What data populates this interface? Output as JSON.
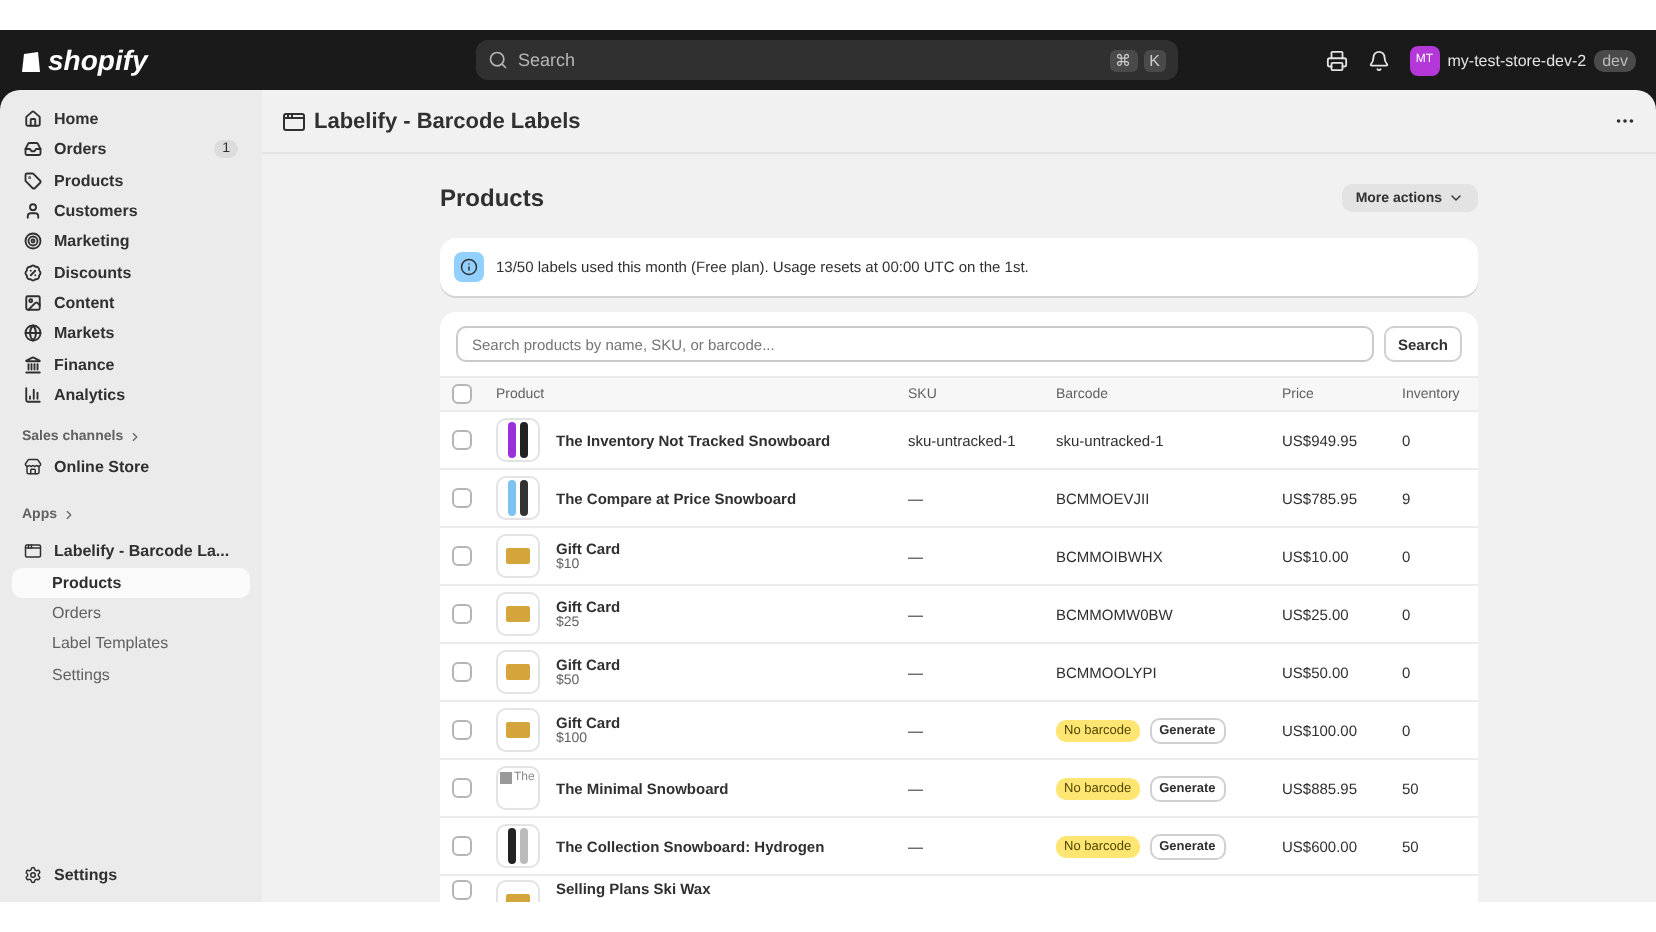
{
  "topbar": {
    "brand": "shopify",
    "search": {
      "placeholder": "Search",
      "keys": [
        "⌘",
        "K"
      ]
    },
    "store": {
      "initials": "MT",
      "name": "my-test-store-dev-2",
      "badge": "dev"
    }
  },
  "sidebar": {
    "items": [
      {
        "label": "Home"
      },
      {
        "label": "Orders",
        "count": "1"
      },
      {
        "label": "Products"
      },
      {
        "label": "Customers"
      },
      {
        "label": "Marketing"
      },
      {
        "label": "Discounts"
      },
      {
        "label": "Content"
      },
      {
        "label": "Markets"
      },
      {
        "label": "Finance"
      },
      {
        "label": "Analytics"
      }
    ],
    "sales_channels": {
      "heading": "Sales channels",
      "items": [
        {
          "label": "Online Store"
        }
      ]
    },
    "apps": {
      "heading": "Apps",
      "app": {
        "label": "Labelify - Barcode La...",
        "children": [
          {
            "label": "Products",
            "selected": true
          },
          {
            "label": "Orders",
            "selected": false
          },
          {
            "label": "Label Templates",
            "selected": false
          },
          {
            "label": "Settings",
            "selected": false
          }
        ]
      }
    },
    "settings": "Settings"
  },
  "app_header": {
    "title": "Labelify - Barcode Labels"
  },
  "page": {
    "title": "Products",
    "more_actions": "More actions",
    "banner": "13/50 labels used this month (Free plan). Usage resets at 00:00 UTC on the 1st.",
    "search": {
      "placeholder": "Search products by name, SKU, or barcode...",
      "button": "Search"
    },
    "table": {
      "columns": [
        "Product",
        "SKU",
        "Barcode",
        "Price",
        "Inventory"
      ],
      "all_checked": false,
      "rows": [
        {
          "kind": "purple-board",
          "name": "The Inventory Not Tracked Snowboard",
          "sku": "sku-untracked-1",
          "barcode": {
            "kind": "value",
            "text": "sku-untracked-1"
          },
          "price": "US$949.95",
          "inventory": "0",
          "checked": false
        },
        {
          "kind": "blue-board",
          "name": "The Compare at Price Snowboard",
          "sku": "—",
          "barcode": {
            "kind": "value",
            "text": "BCMMOEVJII"
          },
          "price": "US$785.95",
          "inventory": "9",
          "checked": false
        },
        {
          "kind": "gift-card",
          "name": "Gift Card",
          "variant": "$10",
          "sku": "—",
          "barcode": {
            "kind": "value",
            "text": "BCMMOIBWHX"
          },
          "price": "US$10.00",
          "inventory": "0",
          "checked": false
        },
        {
          "kind": "gift-card",
          "name": "Gift Card",
          "variant": "$25",
          "sku": "—",
          "barcode": {
            "kind": "value",
            "text": "BCMMOMW0BW"
          },
          "price": "US$25.00",
          "inventory": "0",
          "checked": false
        },
        {
          "kind": "gift-card",
          "name": "Gift Card",
          "variant": "$50",
          "sku": "—",
          "barcode": {
            "kind": "value",
            "text": "BCMMOOLYPI"
          },
          "price": "US$50.00",
          "inventory": "0",
          "checked": false
        },
        {
          "kind": "gift-card",
          "name": "Gift Card",
          "variant": "$100",
          "sku": "—",
          "barcode": {
            "kind": "missing",
            "badge": "No barcode",
            "action": "Generate"
          },
          "price": "US$100.00",
          "inventory": "0",
          "checked": false
        },
        {
          "kind": "broken",
          "thumb_alt": "The",
          "name": "The Minimal Snowboard",
          "sku": "—",
          "barcode": {
            "kind": "missing",
            "badge": "No barcode",
            "action": "Generate"
          },
          "price": "US$885.95",
          "inventory": "50",
          "checked": false
        },
        {
          "kind": "dark-board",
          "name": "The Collection Snowboard: Hydrogen",
          "sku": "—",
          "barcode": {
            "kind": "missing",
            "badge": "No barcode",
            "action": "Generate"
          },
          "price": "US$600.00",
          "inventory": "50",
          "checked": false
        },
        {
          "kind": "gift-card",
          "name": "Selling Plans Ski Wax",
          "checked": false
        }
      ]
    }
  }
}
